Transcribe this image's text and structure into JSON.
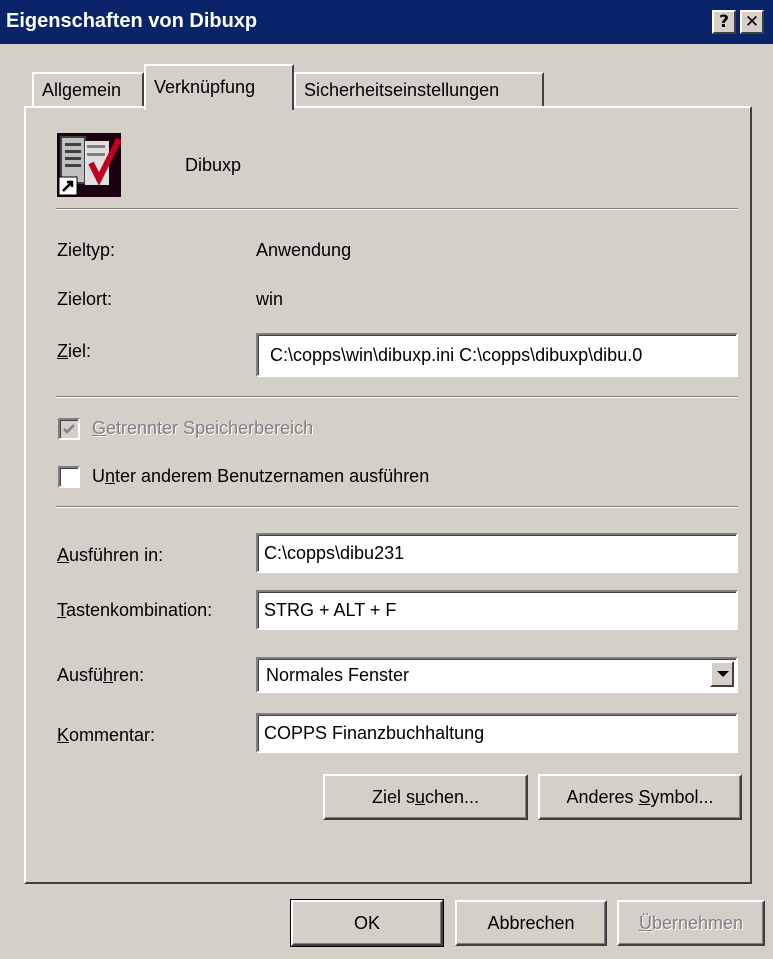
{
  "window": {
    "title": "Eigenschaften von Dibuxp",
    "help_glyph": "?",
    "close_glyph": "✕"
  },
  "tabs": [
    {
      "label": "Allgemein",
      "active": false
    },
    {
      "label": "Verknüpfung",
      "active": true
    },
    {
      "label": "Sicherheitseinstellungen",
      "active": false
    }
  ],
  "app": {
    "name": "Dibuxp",
    "icon": "dibuxp-app-icon"
  },
  "info": {
    "zieltyp_label": "Zieltyp:",
    "zieltyp_value": "Anwendung",
    "zielort_label": "Zielort:",
    "zielort_value": "win"
  },
  "ziel": {
    "label_ul": "Z",
    "label_rest": "iel:",
    "value": "C:\\copps\\win\\dibuxp.ini C:\\copps\\dibuxp\\dibu.0"
  },
  "options": {
    "separate_memory_ul": "G",
    "separate_memory_rest": "etrennter Speicherbereich",
    "separate_memory_checked": true,
    "separate_memory_enabled": false,
    "run_as_pre": "U",
    "run_as_ul": "n",
    "run_as_rest": "ter anderem Benutzernamen ausführen",
    "run_as_checked": false
  },
  "fields": {
    "ausfuehren_in_ul": "A",
    "ausfuehren_in_rest": "usführen in:",
    "ausfuehren_in_value": "C:\\copps\\dibu231",
    "tasten_ul": "T",
    "tasten_rest": "astenkombination:",
    "tasten_value": "STRG + ALT + F",
    "ausfuehren_pre": "Ausfü",
    "ausfuehren_ul": "h",
    "ausfuehren_rest": "ren:",
    "ausfuehren_value": "Normales Fenster",
    "kommentar_ul": "K",
    "kommentar_rest": "ommentar:",
    "kommentar_value": "COPPS Finanzbuchhaltung"
  },
  "buttons": {
    "ziel_suchen_pre": "Ziel s",
    "ziel_suchen_ul": "u",
    "ziel_suchen_rest": "chen...",
    "anderes_symbol_pre": "Anderes ",
    "anderes_symbol_ul": "S",
    "anderes_symbol_rest": "ymbol...",
    "ok": "OK",
    "abbrechen": "Abbrechen",
    "uebernehmen_ul": "Ü",
    "uebernehmen_rest": "bernehmen"
  }
}
